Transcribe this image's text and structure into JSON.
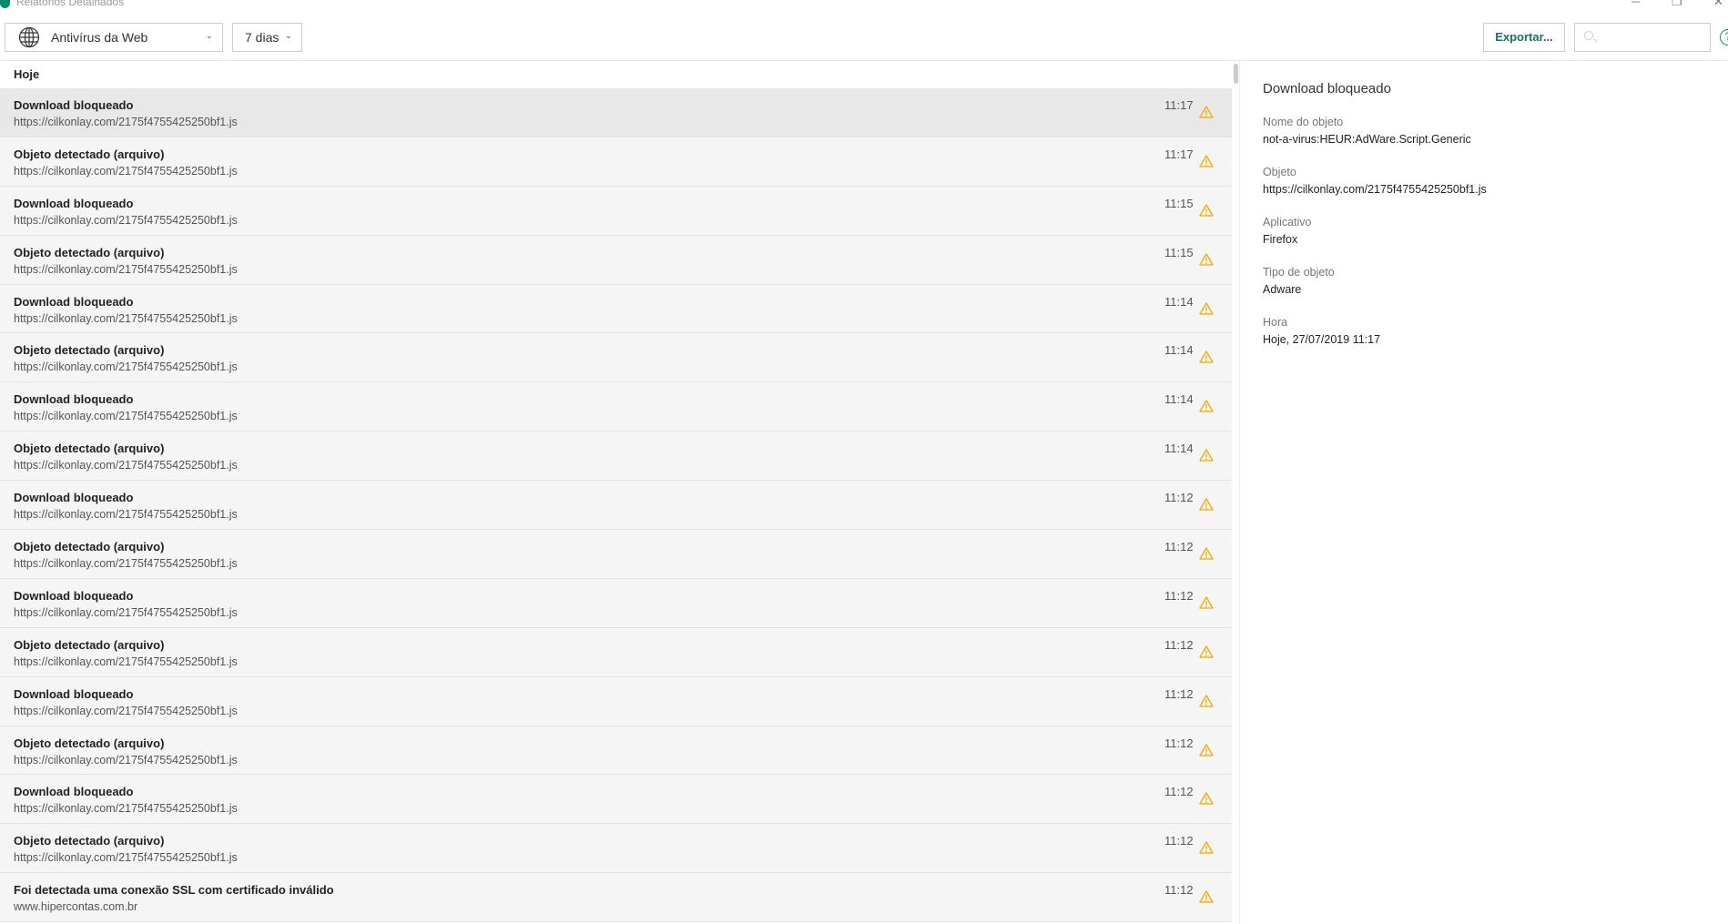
{
  "window": {
    "title": "Relatórios Detalhados",
    "minimize": "─",
    "maximize": "❐",
    "close": "✕"
  },
  "toolbar": {
    "component": "Antivírus da Web",
    "period": "7 dias",
    "export_label": "Exportar...",
    "search_placeholder": "",
    "help": "?"
  },
  "list": {
    "group": "Hoje",
    "rows": [
      {
        "title": "Download bloqueado",
        "url": "https://cilkonlay.com/2175f4755425250bf1.js",
        "time": "11:17"
      },
      {
        "title": "Objeto detectado (arquivo)",
        "url": "https://cilkonlay.com/2175f4755425250bf1.js",
        "time": "11:17"
      },
      {
        "title": "Download bloqueado",
        "url": "https://cilkonlay.com/2175f4755425250bf1.js",
        "time": "11:15"
      },
      {
        "title": "Objeto detectado (arquivo)",
        "url": "https://cilkonlay.com/2175f4755425250bf1.js",
        "time": "11:15"
      },
      {
        "title": "Download bloqueado",
        "url": "https://cilkonlay.com/2175f4755425250bf1.js",
        "time": "11:14"
      },
      {
        "title": "Objeto detectado (arquivo)",
        "url": "https://cilkonlay.com/2175f4755425250bf1.js",
        "time": "11:14"
      },
      {
        "title": "Download bloqueado",
        "url": "https://cilkonlay.com/2175f4755425250bf1.js",
        "time": "11:14"
      },
      {
        "title": "Objeto detectado (arquivo)",
        "url": "https://cilkonlay.com/2175f4755425250bf1.js",
        "time": "11:14"
      },
      {
        "title": "Download bloqueado",
        "url": "https://cilkonlay.com/2175f4755425250bf1.js",
        "time": "11:12"
      },
      {
        "title": "Objeto detectado (arquivo)",
        "url": "https://cilkonlay.com/2175f4755425250bf1.js",
        "time": "11:12"
      },
      {
        "title": "Download bloqueado",
        "url": "https://cilkonlay.com/2175f4755425250bf1.js",
        "time": "11:12"
      },
      {
        "title": "Objeto detectado (arquivo)",
        "url": "https://cilkonlay.com/2175f4755425250bf1.js",
        "time": "11:12"
      },
      {
        "title": "Download bloqueado",
        "url": "https://cilkonlay.com/2175f4755425250bf1.js",
        "time": "11:12"
      },
      {
        "title": "Objeto detectado (arquivo)",
        "url": "https://cilkonlay.com/2175f4755425250bf1.js",
        "time": "11:12"
      },
      {
        "title": "Download bloqueado",
        "url": "https://cilkonlay.com/2175f4755425250bf1.js",
        "time": "11:12"
      },
      {
        "title": "Objeto detectado (arquivo)",
        "url": "https://cilkonlay.com/2175f4755425250bf1.js",
        "time": "11:12"
      },
      {
        "title": "Foi detectada uma conexão SSL com certificado inválido",
        "url": "www.hipercontas.com.br",
        "time": "11:12"
      }
    ]
  },
  "detail": {
    "title": "Download bloqueado",
    "fields": [
      {
        "label": "Nome do objeto",
        "value": "not-a-virus:HEUR:AdWare.Script.Generic"
      },
      {
        "label": "Objeto",
        "value": "https://cilkonlay.com/2175f4755425250bf1.js"
      },
      {
        "label": "Aplicativo",
        "value": "Firefox"
      },
      {
        "label": "Tipo de objeto",
        "value": "Adware"
      },
      {
        "label": "Hora",
        "value": "Hoje, 27/07/2019 11:17"
      }
    ]
  },
  "colors": {
    "accent": "#1c6e6a",
    "warning": "#f5a800",
    "selected": "#e8e8e8"
  }
}
